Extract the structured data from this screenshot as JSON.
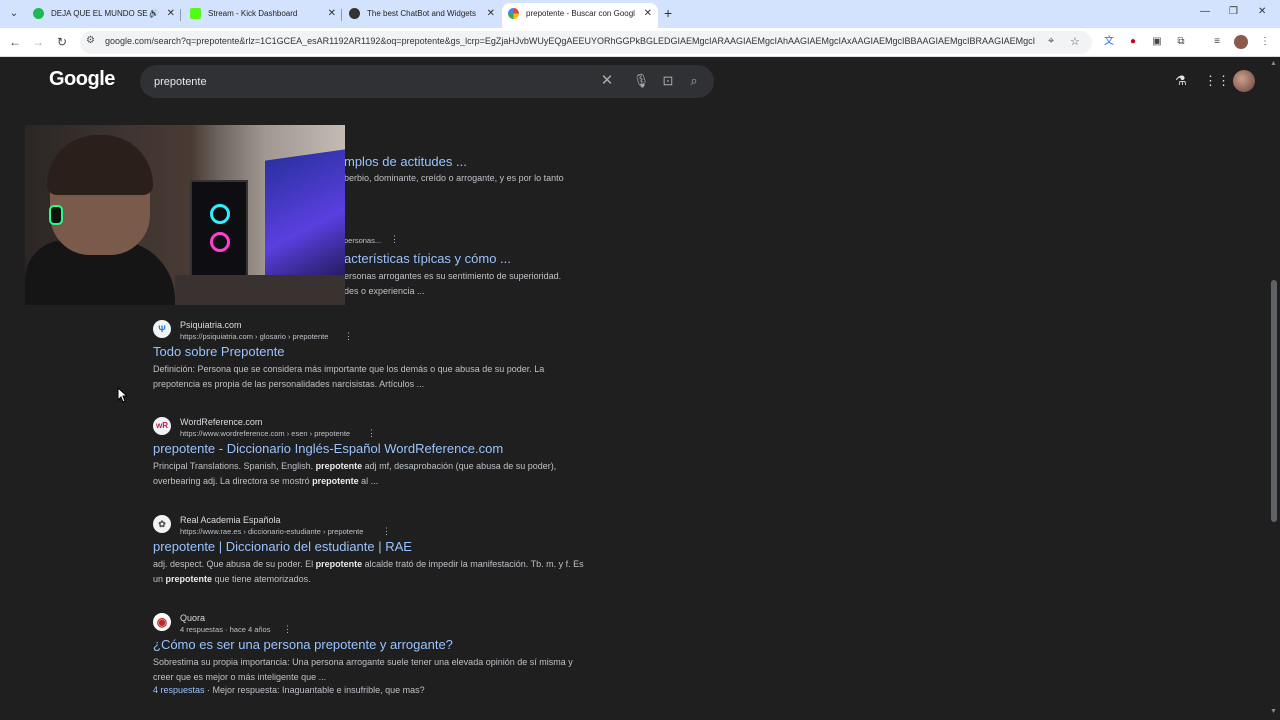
{
  "browser": {
    "tabs": [
      {
        "title": "DEJA QUE EL MUNDO SE A",
        "favicon_color": "#1db954"
      },
      {
        "title": "Stream - Kick Dashboard",
        "favicon_color": "#53fc18"
      },
      {
        "title": "The best ChatBot and Widgets",
        "favicon_color": "#333333"
      },
      {
        "title": "prepotente - Buscar con Googl",
        "favicon_color": "#4285f4"
      }
    ],
    "url": "google.com/search?q=prepotente&rlz=1C1GCEA_esAR1192AR1192&oq=prepotente&gs_lcrp=EgZjaHJvbWUyEQgAEEUYORhGGPkBGLEDGIAEMgcIARAAGIAEMgcIAhAAGIAEMgcIAxAAGIAEMgcIBBAAGIAEMgcIBRAAGIAEMgcIB..."
  },
  "google": {
    "logo": "Google",
    "query": "prepotente"
  },
  "partial_results": {
    "r1_title": "mplos de actitudes ...",
    "r1_snippet": "berbio, dominante, creído o arrogante, y es por lo tanto",
    "r2_url": "personas...",
    "r2_title": "acterísticas típicas y cómo ...",
    "r2_snippet1": "ersonas arrogantes es su sentimiento de superioridad.",
    "r2_snippet2": "des o experiencia ..."
  },
  "results": [
    {
      "site": "Psiquiatria.com",
      "url": "https://psiquiatria.com › glosario › prepotente",
      "title": "Todo sobre Prepotente",
      "snippet": "Definición: Persona que se considera más importante que los demás o que abusa de su poder. La prepotencia es propia de las personalidades narcisistas. Artículos ...",
      "favicon": "Ψ",
      "favicon_color": "#1a73e8"
    },
    {
      "site": "WordReference.com",
      "url": "https://www.wordreference.com › esen › prepotente",
      "title": "prepotente - Diccionario Inglés-Español WordReference.com",
      "snippet_a": "Principal Translations. Spanish, English. ",
      "snippet_b": "prepotente",
      "snippet_c": " adj mf, desaprobación (que abusa de su poder), overbearing adj. La directora se mostró ",
      "snippet_d": "prepotente",
      "snippet_e": " al ...",
      "favicon": "wR",
      "favicon_color": "#c2185b"
    },
    {
      "site": "Real Academia Española",
      "url": "https://www.rae.es › diccionario-estudiante › prepotente",
      "title": "prepotente | Diccionario del estudiante | RAE",
      "snippet_a": "adj. despect. Que abusa de su poder. El ",
      "snippet_b": "prepotente",
      "snippet_c": " alcalde trató de impedir la manifestación. Tb. m. y f. Es un ",
      "snippet_d": "prepotente",
      "snippet_e": " que tiene atemorizados.",
      "favicon": "✿",
      "favicon_color": "#555555"
    },
    {
      "site": "Quora",
      "url": "4 respuestas · hace 4 años",
      "title": "¿Cómo es ser una persona prepotente y arrogante?",
      "snippet": "Sobrestima su propia importancia: Una persona arrogante suele tener una elevada opinión de sí misma y creer que es mejor o más inteligente que ...",
      "answers_link": "4 respuestas",
      "best_answer": "Mejor respuesta: Inaguantable e insufrible, que mas?",
      "favicon": "◉",
      "favicon_color": "#b92b27"
    }
  ],
  "icons": {
    "clear": "close-icon",
    "mic": "microphone-icon",
    "lens": "camera-icon",
    "search": "search-icon",
    "labs": "flask-icon",
    "apps": "apps-grid-icon"
  }
}
